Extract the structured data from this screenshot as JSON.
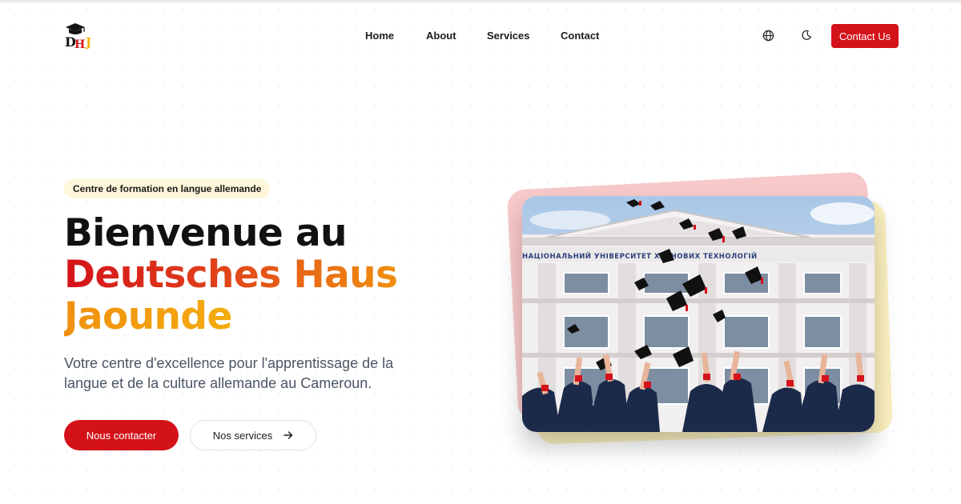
{
  "header": {
    "logo_text": "DHJ",
    "nav": [
      "Home",
      "About",
      "Services",
      "Contact"
    ],
    "icons": [
      "globe-icon",
      "moon-icon"
    ],
    "contact_label": "Contact Us"
  },
  "hero": {
    "badge": "Centre de formation en langue allemande",
    "title_line1": "Bienvenue au",
    "title_line2": "Deutsches Haus",
    "title_line3": "Jaounde",
    "description": "Votre centre d'excellence pour l'apprentissage de la langue et de la culture allemande au Cameroun.",
    "primary_button": "Nous contacter",
    "secondary_button": "Nos services",
    "image_signage": "НАЦІОНАЛЬНИЙ УНІВЕРСИТЕТ ХАРЧОВИХ ТЕХНОЛОГІЙ"
  },
  "colors": {
    "brand_red": "#d4121a",
    "gradient_orange": "#f0900f",
    "gradient_yellow": "#f8c80c",
    "badge_bg": "#fdf6da"
  }
}
